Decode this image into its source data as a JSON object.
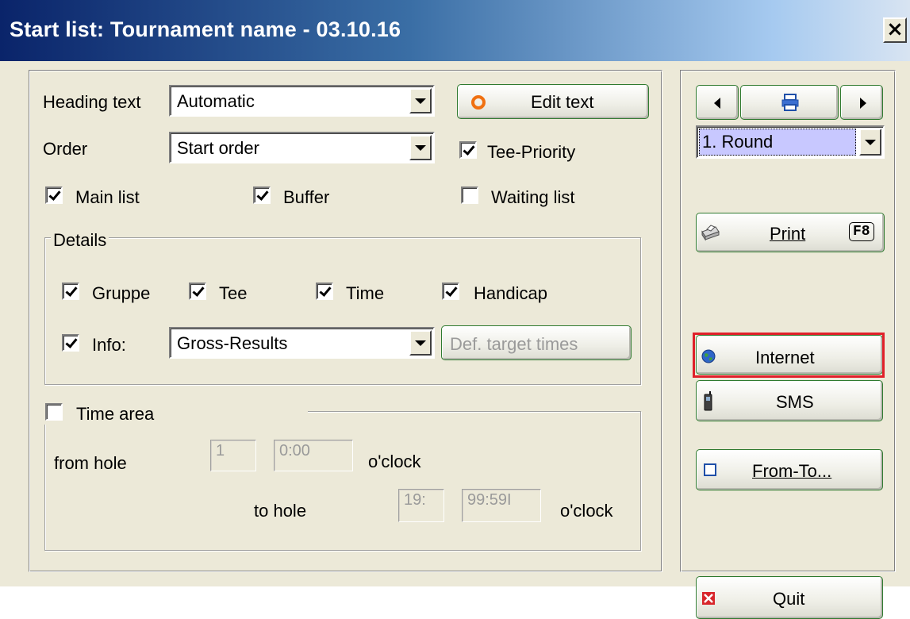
{
  "window": {
    "title": "Start list: Tournament name - 03.10.16",
    "close_label": "×"
  },
  "form": {
    "heading_label": "Heading text",
    "heading_value": "Automatic",
    "edit_text_label": "Edit text",
    "order_label": "Order",
    "order_value": "Start order",
    "tee_priority_label": "Tee-Priority",
    "tee_priority_checked": true,
    "main_list_label": "Main list",
    "main_list_checked": true,
    "buffer_label": "Buffer",
    "buffer_checked": true,
    "waiting_list_label": "Waiting list",
    "waiting_list_checked": false
  },
  "details": {
    "legend": "Details",
    "gruppe_label": "Gruppe",
    "tee_label": "Tee",
    "time_label": "Time",
    "handicap_label": "Handicap",
    "info_label": "Info:",
    "info_value": "Gross-Results",
    "def_target_label": "Def. target times"
  },
  "time_area": {
    "label": "Time area",
    "checked": false,
    "from_hole_label": "from hole",
    "from_hole_value": "1",
    "from_time_value": "0:00",
    "from_oclock": "o'clock",
    "to_hole_label": "to hole",
    "to_hole_value": "19:",
    "to_time_value": "99:59I",
    "to_oclock": "o'clock"
  },
  "side": {
    "round_value": "1. Round",
    "print_label": "Print",
    "print_shortcut": "F8",
    "internet_label": "Internet",
    "sms_label": "SMS",
    "from_to_label": "From-To...",
    "quit_label": "Quit"
  },
  "icons": {
    "edit": "orange-ring-icon",
    "print": "printer-icon",
    "internet": "globe-icon",
    "sms": "mobile-phone-icon",
    "from_to": "square-icon",
    "quit": "red-x-icon"
  },
  "colors": {
    "title_bar_start": "#0a246a",
    "highlight": "#e0202a",
    "button_border": "#2f7a2f"
  }
}
